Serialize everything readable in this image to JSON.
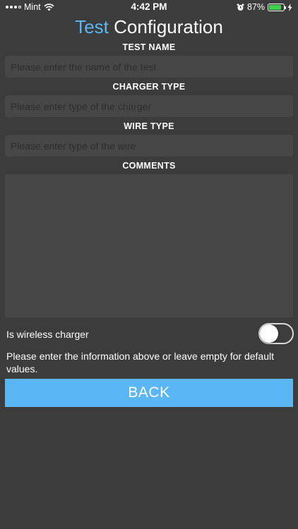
{
  "status_bar": {
    "carrier": "Mint",
    "time": "4:42 PM",
    "battery_percent": "87%",
    "battery_level": 0.87,
    "icons": [
      "signal-icon",
      "wifi-icon",
      "alarm-icon",
      "battery-icon",
      "charging-bolt-icon"
    ]
  },
  "header": {
    "title_accent": "Test",
    "title_rest": "Configuration",
    "accent_color": "#5bb6f5"
  },
  "form": {
    "test_name": {
      "label": "TEST NAME",
      "value": "",
      "placeholder": "Please enter the name of the test"
    },
    "charger_type": {
      "label": "CHARGER TYPE",
      "value": "",
      "placeholder": "Please enter type of the charger"
    },
    "wire_type": {
      "label": "WIRE TYPE",
      "value": "",
      "placeholder": "Please enter type of the wire"
    },
    "comments": {
      "label": "COMMENTS",
      "value": ""
    },
    "wireless": {
      "label": "Is wireless charger",
      "on": false
    },
    "info": "Please enter the information above or leave empty for default values.",
    "back_label": "BACK"
  }
}
